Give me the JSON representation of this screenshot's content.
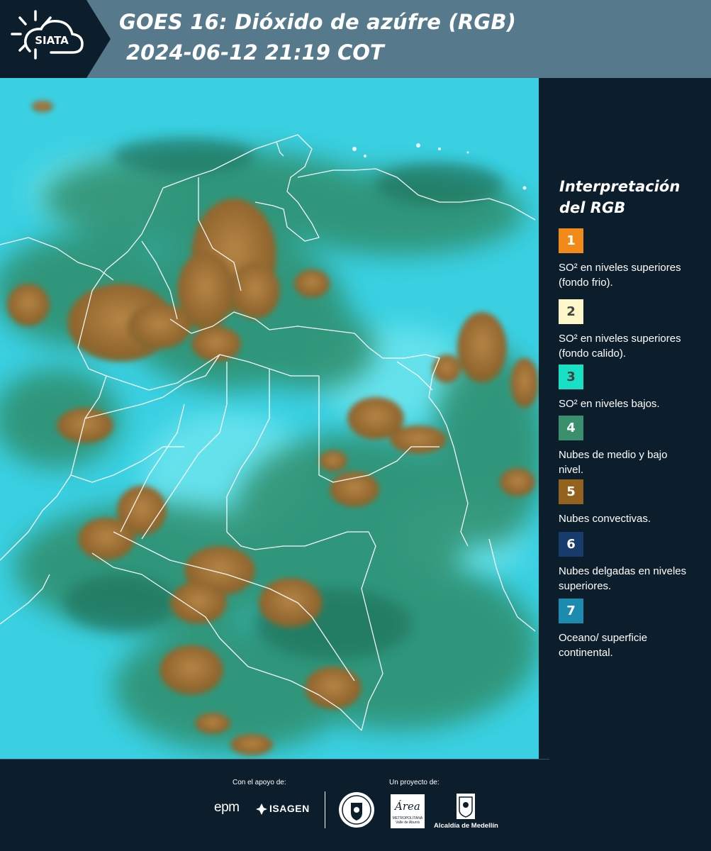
{
  "header": {
    "logo_text": "SIATA",
    "title": "GOES 16: Dióxido de azúfre (RGB)",
    "subtitle": " 2024-06-12 21:19 COT"
  },
  "map": {
    "icon": "satellite-rgb-image",
    "colors": {
      "ocean": "#3fd6e6",
      "cloud_low": "#2f8a6c",
      "convective": "#9a6f38",
      "boundary": "#ffffff"
    }
  },
  "legend": {
    "title": "Interpretación del RGB",
    "items": [
      {
        "number": "1",
        "color": "#f28a1a",
        "text_color": "#ffffff",
        "label": "SO² en niveles superiores (fondo frio)."
      },
      {
        "number": "2",
        "color": "#fdf6c8",
        "text_color": "#404040",
        "label": "SO² en niveles superiores (fondo calido)."
      },
      {
        "number": "3",
        "color": "#19e0c4",
        "text_color": "#404040",
        "label": "SO² en niveles bajos."
      },
      {
        "number": "4",
        "color": "#3a8f6c",
        "text_color": "#ffffff",
        "label": "Nubes de medio y bajo nivel."
      },
      {
        "number": "5",
        "color": "#93621e",
        "text_color": "#ffffff",
        "label": "Nubes convectivas."
      },
      {
        "number": "6",
        "color": "#173b6b",
        "text_color": "#ffffff",
        "label": "Nubes delgadas en niveles superiores."
      },
      {
        "number": "7",
        "color": "#1b8cb0",
        "text_color": "#ffffff",
        "label": "Oceano/ superficie continental."
      }
    ]
  },
  "footer": {
    "support_label": "Con el apoyo de:",
    "project_label": "Un proyecto de:",
    "epm": "epm",
    "isagen": "ISAGEN",
    "area_word": "Área",
    "area_sub": "METROPOLITANA Valle de Aburrá",
    "alcaldia": "Alcaldía de Medellín"
  }
}
